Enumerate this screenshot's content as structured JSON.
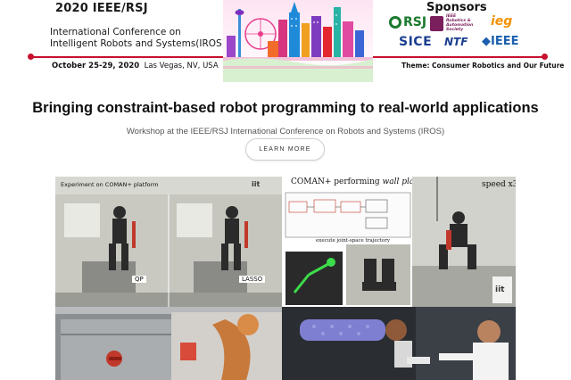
{
  "banner": {
    "conf_title": "2020 IEEE/RSJ",
    "conf_line1": "International Conference on",
    "conf_line2": "Intelligent Robots and Systems(IROS)",
    "date": "October 25-29, 2020",
    "location": "Las Vegas, NV, USA",
    "theme": "Theme: Consumer Robotics and Our Future",
    "accent_color": "#c8102e"
  },
  "sponsors": {
    "title": "Sponsors",
    "items": [
      {
        "name": "RSJ",
        "color": "#1a7a2e"
      },
      {
        "name": "IEEE Robotics & Automation Society",
        "color": "#7a1f5c"
      },
      {
        "name": "ieg",
        "color": "#f39200"
      },
      {
        "name": "SICE",
        "color": "#1b3f8f"
      },
      {
        "name": "NTF",
        "color": "#1b3f8f"
      },
      {
        "name": "IEEE",
        "color": "#1b5fae"
      }
    ]
  },
  "hero": {
    "headline": "Bringing constraint-based robot programming to real-world applications",
    "subline": "Workshop at the IEEE/RSJ International Conference on Robots and Systems (IROS)",
    "cta_label": "LEARN MORE"
  },
  "media": {
    "experiment_caption": "Experiment on COMAN+ platform",
    "qp_label": "QP",
    "lasso_label": "LASSO",
    "plank_caption_prefix": "COMAN+ performing",
    "plank_caption_emph": "wall plank",
    "trajectory_caption": "execute joint-space trajectory",
    "speed_caption": "speed x3",
    "iit_logo": "iit"
  }
}
